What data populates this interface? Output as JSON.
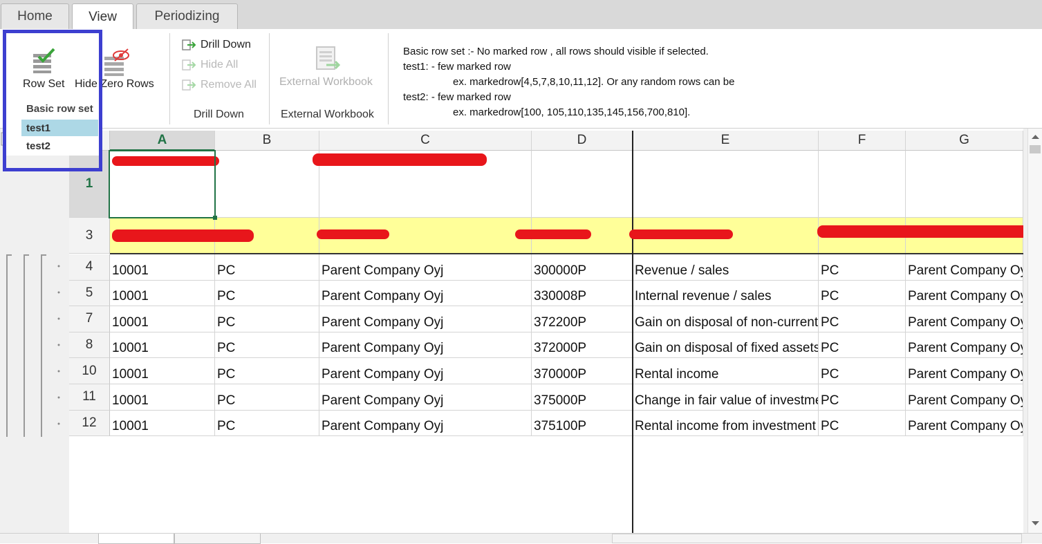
{
  "tabs": [
    {
      "label": "Home",
      "active": false
    },
    {
      "label": "View",
      "active": true
    },
    {
      "label": "Periodizing",
      "active": false
    }
  ],
  "ribbon": {
    "row_set_label": "Row Set",
    "hide_zero_rows_label": "Hide Zero Rows",
    "drill_down_items": [
      "Drill Down",
      "Hide All",
      "Remove All"
    ],
    "drill_down_group": "Drill Down",
    "external_workbook_button": "External Workbook",
    "external_workbook_group": "External Workbook",
    "description_lines": [
      "Basic row set :- No marked row , all rows should visible if selected.",
      "test1: - few marked row",
      "ex. markedrow[4,5,7,8,10,11,12]. Or any random rows can be",
      "test2: - few marked row",
      "ex. markedrow[100, 105,110,135,145,156,700,810]."
    ]
  },
  "dropdown": {
    "header": "Basic row set",
    "items": [
      {
        "label": "test1",
        "selected": true
      },
      {
        "label": "test2",
        "selected": false
      }
    ]
  },
  "columns": [
    "A",
    "B",
    "C",
    "D",
    "E",
    "F",
    "G"
  ],
  "selected_cell": "A1",
  "header_rows": [
    {
      "row": "1"
    },
    {
      "row": "3"
    }
  ],
  "rows": [
    {
      "row": "4",
      "cells": [
        "10001",
        "PC",
        "Parent Company Oyj",
        "300000P",
        "Revenue / sales",
        "PC",
        "Parent Company Oyj"
      ]
    },
    {
      "row": "5",
      "cells": [
        "10001",
        "PC",
        "Parent Company Oyj",
        "330008P",
        "Internal revenue / sales",
        "PC",
        "Parent Company Oyj"
      ]
    },
    {
      "row": "7",
      "cells": [
        "10001",
        "PC",
        "Parent Company Oyj",
        "372200P",
        "Gain on disposal of non-current assets",
        "PC",
        "Parent Company Oyj"
      ]
    },
    {
      "row": "8",
      "cells": [
        "10001",
        "PC",
        "Parent Company Oyj",
        "372000P",
        "Gain on disposal of fixed assets",
        "PC",
        "Parent Company Oyj"
      ]
    },
    {
      "row": "10",
      "cells": [
        "10001",
        "PC",
        "Parent Company Oyj",
        "370000P",
        "Rental income",
        "PC",
        "Parent Company Oyj"
      ]
    },
    {
      "row": "11",
      "cells": [
        "10001",
        "PC",
        "Parent Company Oyj",
        "375000P",
        "Change in fair value of investment property",
        "PC",
        "Parent Company Oyj"
      ]
    },
    {
      "row": "12",
      "cells": [
        "10001",
        "PC",
        "Parent Company Oyj",
        "375100P",
        "Rental income from investment property",
        "PC",
        "Parent Company Oyj"
      ]
    }
  ],
  "colors": {
    "accent_green": "#217346",
    "highlight_border": "#3d3fd0",
    "selected_item": "#add8e6",
    "header_row_fill": "#ffff99",
    "redaction": "#e8161b"
  }
}
